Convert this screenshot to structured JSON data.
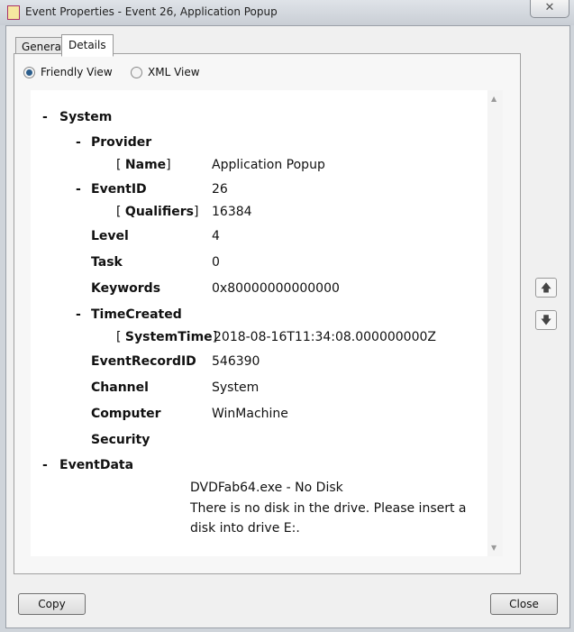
{
  "window": {
    "title": "Event Properties - Event 26, Application Popup",
    "close": "✕"
  },
  "tabs": [
    "General",
    "Details"
  ],
  "views": {
    "friendly": "Friendly View",
    "xml": "XML View"
  },
  "tree": {
    "dash": "-",
    "system": "System",
    "provider": "Provider",
    "name_key": "Name",
    "name_val": "Application Popup",
    "eventid": "EventID",
    "eventid_val": "26",
    "qualifiers_key": "Qualifiers",
    "qualifiers_val": "16384",
    "level": "Level",
    "level_val": "4",
    "task": "Task",
    "task_val": "0",
    "keywords": "Keywords",
    "keywords_val": "0x80000000000000",
    "timecreated": "TimeCreated",
    "systemtime_key": "SystemTime",
    "systemtime_val": "2018-08-16T11:34:08.000000000Z",
    "recordid": "EventRecordID",
    "recordid_val": "546390",
    "channel": "Channel",
    "channel_val": "System",
    "computer": "Computer",
    "computer_val": "WinMachine",
    "security": "Security",
    "eventdata": "EventData",
    "data_line1": "DVDFab64.exe - No Disk",
    "data_line2": "There is no disk in the drive. Please insert a",
    "data_line3": "disk into drive E:."
  },
  "buttons": {
    "copy": "Copy",
    "close": "Close",
    "up": "🡅",
    "down": "🡇"
  }
}
